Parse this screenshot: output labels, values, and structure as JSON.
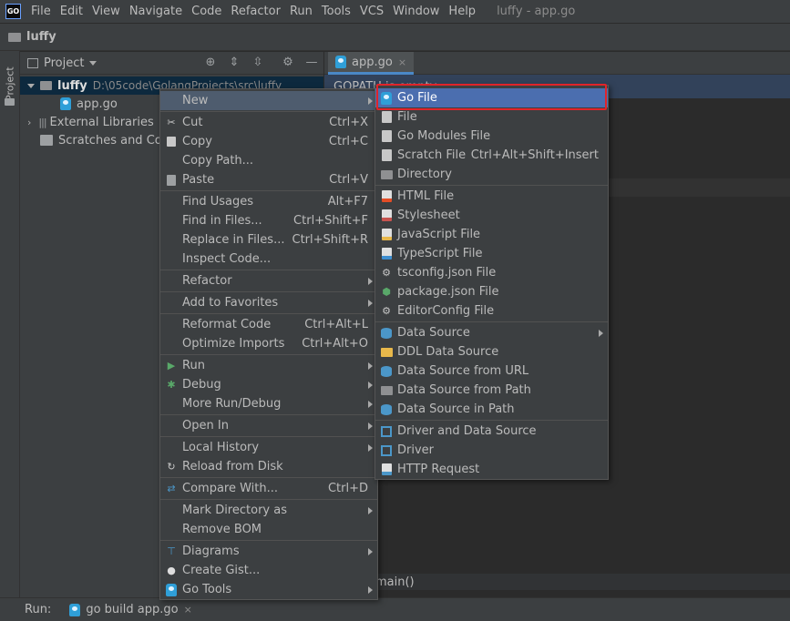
{
  "menubar": {
    "logo": "GO",
    "items": [
      "File",
      "Edit",
      "View",
      "Navigate",
      "Code",
      "Refactor",
      "Run",
      "Tools",
      "VCS",
      "Window",
      "Help"
    ],
    "title": "luffy - app.go"
  },
  "navbar": {
    "project": "luffy"
  },
  "left_strip": {
    "tab": "Project"
  },
  "project_panel": {
    "title": "Project",
    "root": {
      "name": "luffy",
      "path": "D:\\05code\\GolangProjects\\src\\luffy"
    },
    "file": "app.go",
    "external_libraries": "External Libraries",
    "scratches": "Scratches and Cons"
  },
  "editor": {
    "tab": "app.go",
    "banner": "GOPATH is empty",
    "bottom_text": "main()"
  },
  "runbar": {
    "label": "Run:",
    "tab": "go build app.go"
  },
  "context_menu": {
    "new": "New",
    "cut": "Cut",
    "cut_sc": "Ctrl+X",
    "copy": "Copy",
    "copy_sc": "Ctrl+C",
    "copy_path": "Copy Path...",
    "paste": "Paste",
    "paste_sc": "Ctrl+V",
    "find_usages": "Find Usages",
    "find_usages_sc": "Alt+F7",
    "find_in_files": "Find in Files...",
    "find_in_files_sc": "Ctrl+Shift+F",
    "replace_in_files": "Replace in Files...",
    "replace_in_files_sc": "Ctrl+Shift+R",
    "inspect_code": "Inspect Code...",
    "refactor": "Refactor",
    "add_to_favorites": "Add to Favorites",
    "reformat_code": "Reformat Code",
    "reformat_code_sc": "Ctrl+Alt+L",
    "optimize_imports": "Optimize Imports",
    "optimize_imports_sc": "Ctrl+Alt+O",
    "run": "Run",
    "debug": "Debug",
    "more_run_debug": "More Run/Debug",
    "open_in": "Open In",
    "local_history": "Local History",
    "reload_from_disk": "Reload from Disk",
    "compare_with": "Compare With...",
    "compare_with_sc": "Ctrl+D",
    "mark_directory_as": "Mark Directory as",
    "remove_bom": "Remove BOM",
    "diagrams": "Diagrams",
    "create_gist": "Create Gist...",
    "go_tools": "Go Tools"
  },
  "new_submenu": {
    "go_file": "Go File",
    "file": "File",
    "go_modules_file": "Go Modules File",
    "scratch_file": "Scratch File",
    "scratch_file_sc": "Ctrl+Alt+Shift+Insert",
    "directory": "Directory",
    "html_file": "HTML File",
    "stylesheet": "Stylesheet",
    "javascript_file": "JavaScript File",
    "typescript_file": "TypeScript File",
    "tsconfig_file": "tsconfig.json File",
    "package_json_file": "package.json File",
    "editorconfig_file": "EditorConfig File",
    "data_source": "Data Source",
    "ddl_data_source": "DDL Data Source",
    "data_source_from_url": "Data Source from URL",
    "data_source_from_path": "Data Source from Path",
    "data_source_in_path": "Data Source in Path",
    "driver_and_data_source": "Driver and Data Source",
    "driver": "Driver",
    "http_request": "HTTP Request"
  },
  "colors": {
    "selection": "#4b6eaf",
    "highlight_box": "#e0242a",
    "menu_bg": "#3c3f41"
  }
}
